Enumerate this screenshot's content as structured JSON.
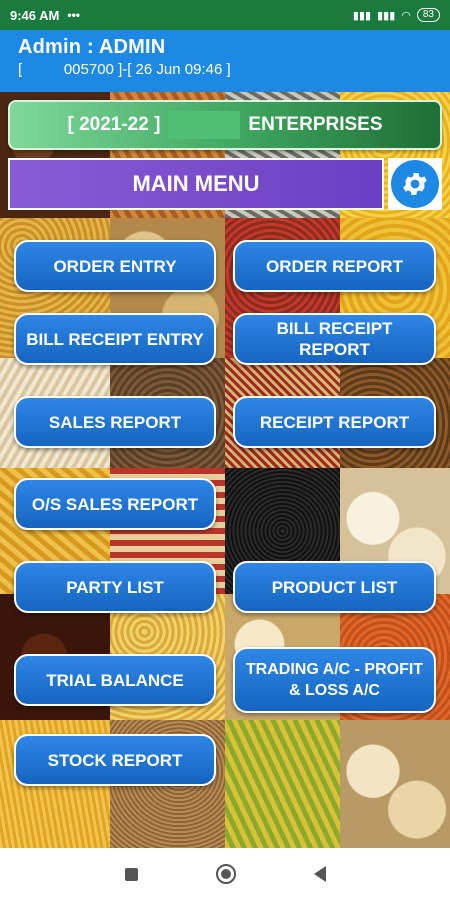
{
  "status_bar": {
    "time": "9:46 AM",
    "network_1": "Vo\nLTE",
    "network_2": "Vo\nLTE",
    "battery": "83"
  },
  "app_bar": {
    "title": "Admin : ADMIN",
    "subtitle": "[          005700 ]-[ 26 Jun 09:46 ]"
  },
  "company": {
    "year": "[ 2021-22 ]",
    "name": "ENTERPRISES"
  },
  "main_menu": {
    "title": "MAIN MENU",
    "settings_icon": "gear-icon"
  },
  "menu": {
    "order_entry": "ORDER ENTRY",
    "order_report": "ORDER REPORT",
    "bill_receipt_entry": "BILL RECEIPT ENTRY",
    "bill_receipt_report": "BILL RECEIPT REPORT",
    "sales_report": "SALES REPORT",
    "receipt_report": "RECEIPT REPORT",
    "os_sales_report": "O/S SALES REPORT",
    "party_list": "PARTY LIST",
    "product_list": "PRODUCT LIST",
    "trial_balance": "TRIAL BALANCE",
    "trading_pl": "TRADING A/C - PROFIT & LOSS A/C",
    "stock_report": "STOCK REPORT"
  },
  "colors": {
    "status_bar": "#1b7a3d",
    "app_bar": "#1e88e5",
    "button": "#1e73d6",
    "main_menu": "#7a4ccf",
    "company_banner": "#3ea55e"
  }
}
